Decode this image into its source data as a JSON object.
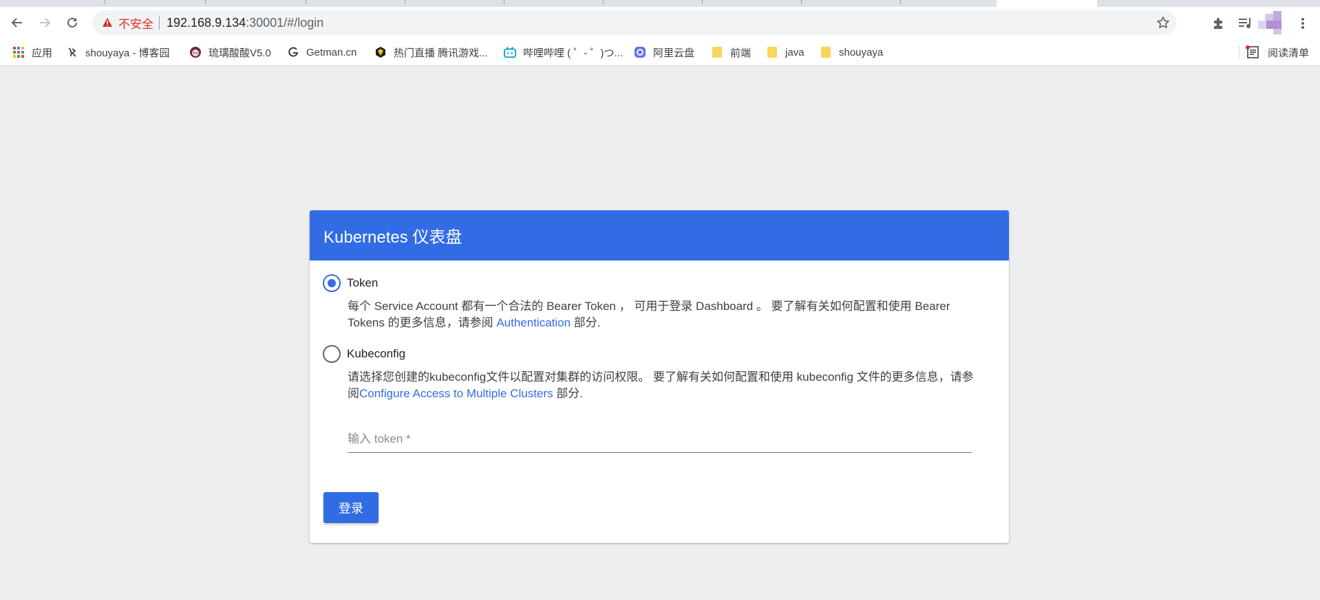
{
  "browser": {
    "address": {
      "security_label": "不安全",
      "host": "192.168.9.134",
      "path": ":30001/#/login"
    },
    "bookmarks": [
      {
        "label": "应用",
        "icon": "apps-grid-icon"
      },
      {
        "label": "shouyaya - 博客园",
        "icon": "cnblogs-icon"
      },
      {
        "label": "琉璃酸酸V5.0",
        "icon": "anime-avatar-icon"
      },
      {
        "label": "Getman.cn",
        "icon": "g-letter-icon"
      },
      {
        "label": "热门直播 腾讯游戏...",
        "icon": "tencent-game-icon"
      },
      {
        "label": "哔哩哔哩 ( ゜- ゜)つ...",
        "icon": "bilibili-icon"
      },
      {
        "label": "阿里云盘",
        "icon": "aliyun-drive-icon"
      },
      {
        "label": "前端",
        "icon": "folder-icon"
      },
      {
        "label": "java",
        "icon": "folder-icon"
      },
      {
        "label": "shouyaya",
        "icon": "folder-icon"
      }
    ],
    "reading_list_label": "阅读清单"
  },
  "login": {
    "title": "Kubernetes 仪表盘",
    "token_option": {
      "label": "Token",
      "selected": true,
      "description_prefix": "每个 Service Account 都有一个合法的 Bearer Token ， 可用于登录 Dashboard 。 要了解有关如何配置和使用 Bearer Tokens 的更多信息，请参阅 ",
      "link": "Authentication",
      "description_suffix": " 部分."
    },
    "kubeconfig_option": {
      "label": "Kubeconfig",
      "selected": false,
      "description_prefix": "请选择您创建的kubeconfig文件以配置对集群的访问权限。 要了解有关如何配置和使用 kubeconfig 文件的更多信息，请参阅",
      "link": "Configure Access to Multiple Clusters",
      "description_suffix": " 部分."
    },
    "token_placeholder": "输入 token *",
    "login_button": "登录"
  },
  "colors": {
    "primary": "#326ce5",
    "page_background": "#edeef0",
    "insecure": "#d93025"
  }
}
